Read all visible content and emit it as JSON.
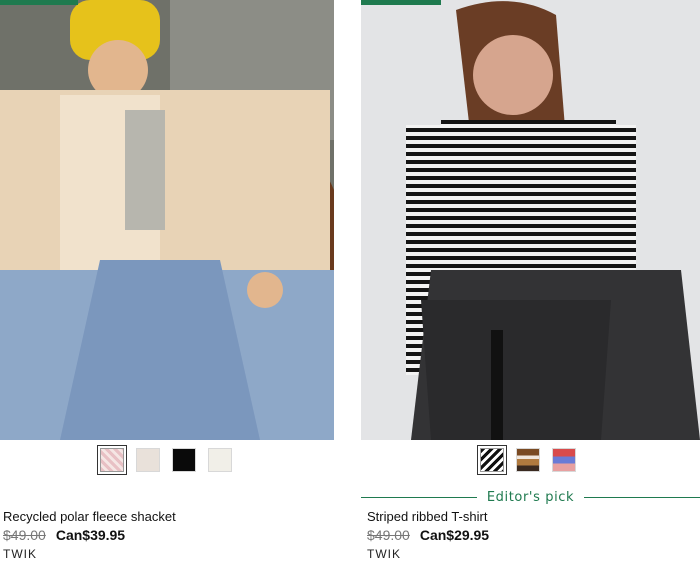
{
  "products": [
    {
      "name": "Recycled polar fleece shacket",
      "old_price": "$49.00",
      "new_price": "Can$39.95",
      "brand": "TWIK",
      "swatches": [
        {
          "label": "pink plaid",
          "color": "#e8c0c4",
          "selected": true
        },
        {
          "label": "beige",
          "color": "#e9e1da",
          "selected": false
        },
        {
          "label": "black",
          "color": "#0a0a0a",
          "selected": false
        },
        {
          "label": "off-white",
          "color": "#f1efe8",
          "selected": false
        }
      ]
    },
    {
      "name": "Striped ribbed T-shirt",
      "old_price": "$49.00",
      "new_price": "Can$29.95",
      "brand": "TWIK",
      "editor_pick": "Editor's pick",
      "swatches": [
        {
          "label": "black white stripes",
          "color": "#222222",
          "selected": true
        },
        {
          "label": "brown stripes",
          "color": "#9a6a3a",
          "selected": false
        },
        {
          "label": "multicolor stripes",
          "color": "#d86a6a",
          "selected": false
        }
      ]
    }
  ],
  "colors": {
    "accent": "#1f7a4f"
  }
}
